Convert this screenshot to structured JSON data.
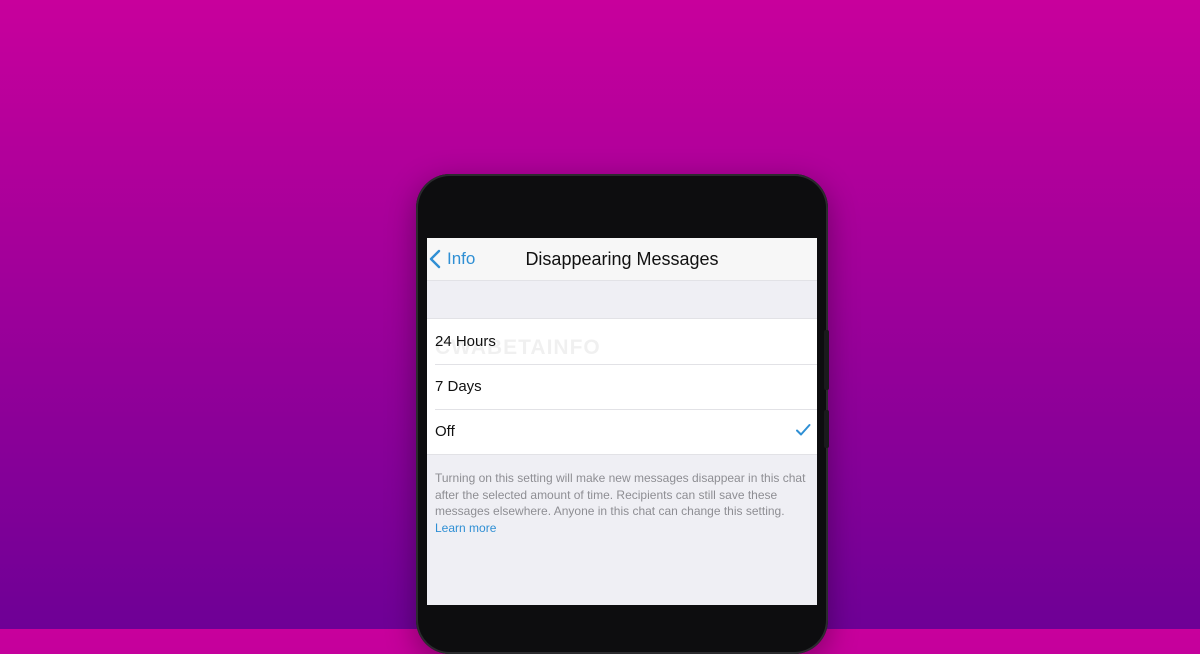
{
  "navbar": {
    "back_label": "Info",
    "title": "Disappearing Messages"
  },
  "options": [
    {
      "label": "24 Hours",
      "selected": false
    },
    {
      "label": "7 Days",
      "selected": false
    },
    {
      "label": "Off",
      "selected": true
    }
  ],
  "watermark": "CWABETAINFO",
  "footer": {
    "text": "Turning on this setting will make new messages disappear in this chat after the selected amount of time. Recipients can still save these messages elsewhere. Anyone in this chat can change this setting.",
    "link": "Learn more"
  },
  "colors": {
    "accent": "#2f8fd4",
    "background_top": "#c8009c",
    "background_bottom": "#6e0096"
  }
}
